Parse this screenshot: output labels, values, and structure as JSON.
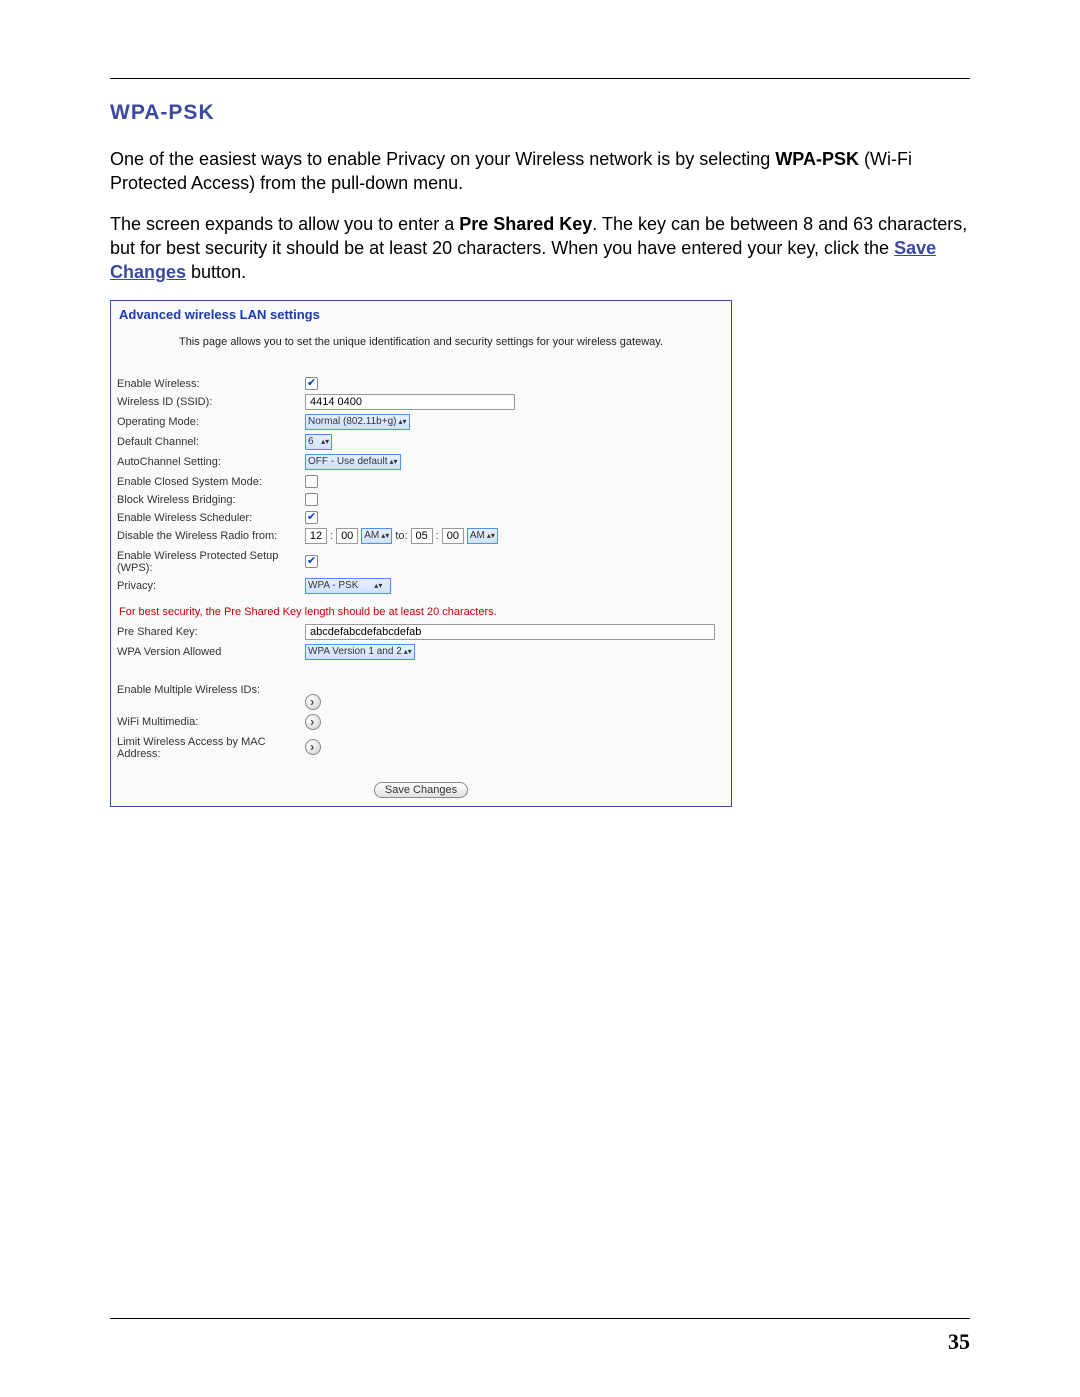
{
  "page_number": "35",
  "section_heading": "WPA-PSK",
  "intro": {
    "line1": "One of the easiest ways to enable Privacy on your Wireless network is by selecting ",
    "bold1": "WPA-PSK",
    "line2": " (Wi-Fi Protected Access) from the pull-down menu."
  },
  "para2": {
    "pre": "The screen expands to allow you to enter a ",
    "bold": "Pre Shared Key",
    "mid": ". The key can be between 8 and 63 characters, but for best security it should be at least 20 characters. When you have entered your key, click the ",
    "link": "Save Changes",
    "post": " button."
  },
  "panel": {
    "title": "Advanced wireless LAN settings",
    "description": "This page allows you to set the unique identification and security settings for your wireless gateway.",
    "rows": {
      "enable_wireless": "Enable Wireless:",
      "ssid_label": "Wireless ID (SSID):",
      "ssid_value": "4414 0400",
      "op_mode_label": "Operating Mode:",
      "op_mode_value": "Normal (802.11b+g)",
      "channel_label": "Default Channel:",
      "channel_value": "6",
      "autochannel_label": "AutoChannel Setting:",
      "autochannel_value": "OFF - Use default",
      "closed_label": "Enable Closed System Mode:",
      "block_bridge_label": "Block Wireless Bridging:",
      "scheduler_label": "Enable Wireless Scheduler:",
      "disable_radio_label": "Disable the Wireless Radio from:",
      "time_from_h": "12",
      "time_from_m": "00",
      "ampm1": "AM",
      "to_text": "to:",
      "time_to_h": "05",
      "time_to_m": "00",
      "ampm2": "AM",
      "wps_label": "Enable Wireless Protected Setup (WPS):",
      "privacy_label": "Privacy:",
      "privacy_value": "WPA - PSK",
      "warn": "For best security, the Pre Shared Key length should be at least 20 characters.",
      "psk_label": "Pre Shared Key:",
      "psk_value": "abcdefabcdefabcdefab",
      "wpa_ver_label": "WPA Version Allowed",
      "wpa_ver_value": "WPA Version 1 and 2",
      "multi_ids_label": "Enable Multiple Wireless IDs:",
      "wmm_label": "WiFi Multimedia:",
      "mac_label": "Limit Wireless Access by MAC Address:",
      "save_button": "Save Changes"
    }
  }
}
